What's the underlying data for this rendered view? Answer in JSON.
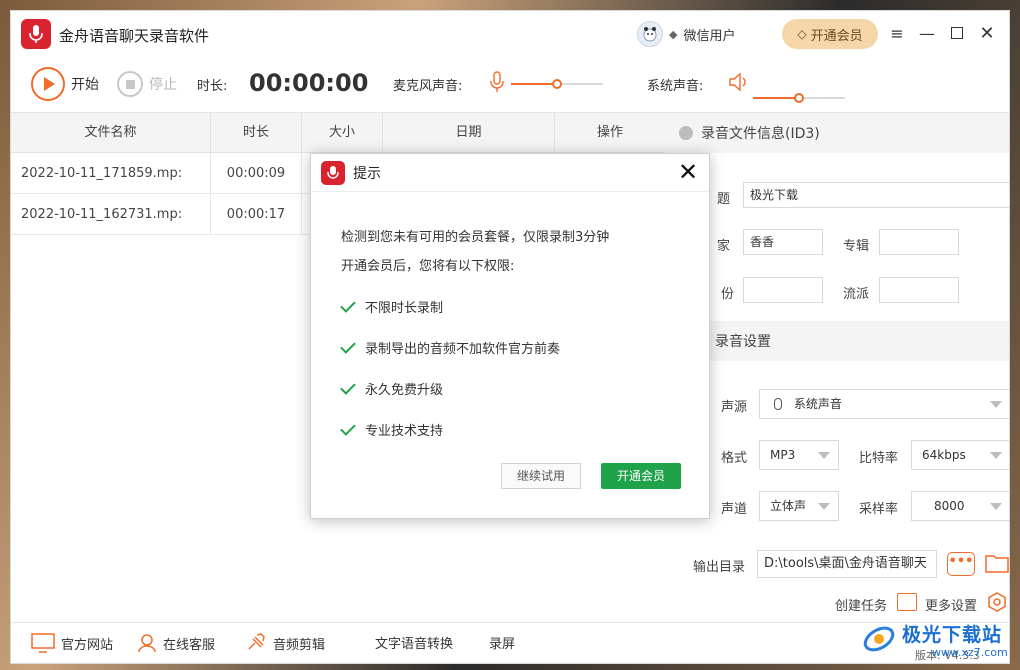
{
  "app": {
    "title": "金舟语音聊天录音软件"
  },
  "header": {
    "user_name": "微信用户",
    "vip_label": "开通会员"
  },
  "toolbar": {
    "start_label": "开始",
    "stop_label": "停止",
    "duration_label": "时长:",
    "timer": "00:00:00",
    "mic_label": "麦克风声音:",
    "mic_volume": 0.5,
    "system_label": "系统声音:",
    "system_volume": 0.5
  },
  "table": {
    "columns": [
      "文件名称",
      "时长",
      "大小",
      "日期",
      "操作"
    ],
    "rows": [
      {
        "name": "2022-10-11_171859.mp:",
        "duration": "00:00:09"
      },
      {
        "name": "2022-10-11_162731.mp:",
        "duration": "00:00:17"
      }
    ]
  },
  "right_panel": {
    "info_title": "录音文件信息(ID3)",
    "title_label": "题",
    "title_value": "极光下载",
    "artist_label": "家",
    "artist_value": "香香",
    "album_label": "专辑",
    "album_value": "",
    "year_label": "份",
    "year_value": "",
    "genre_label": "流派",
    "genre_value": "",
    "settings_title": "录音设置",
    "source_label": "声源",
    "source_value": "系统声音",
    "format_label": "格式",
    "format_value": "MP3",
    "bitrate_label": "比特率",
    "bitrate_value": "64kbps",
    "channel_label": "声道",
    "channel_value": "立体声",
    "samplerate_label": "采样率",
    "samplerate_value": "8000",
    "output_label": "输出目录",
    "output_value": "D:\\tools\\桌面\\金舟语音聊天",
    "create_task_label": "创建任务",
    "more_settings_label": "更多设置"
  },
  "bottom": {
    "website": "官方网站",
    "support": "在线客服",
    "audio_edit": "音频剪辑",
    "tts": "文字语音转换",
    "screen_rec": "录屏",
    "version": "版本: V4.3.3"
  },
  "dialog": {
    "title": "提示",
    "line1": "检测到您未有可用的会员套餐，仅限录制3分钟",
    "line2": "开通会员后，您将有以下权限:",
    "perks": [
      "不限时长录制",
      "录制导出的音频不加软件官方前奏",
      "永久免费升级",
      "专业技术支持"
    ],
    "trial_label": "继续试用",
    "vip_label": "开通会员"
  },
  "watermark": {
    "brand": "极光下载站",
    "url": "www.xz7.com"
  },
  "colors": {
    "accent": "#f06c2a",
    "brand_red": "#d9232e",
    "vip_gold": "#f5d6a8",
    "confirm_green": "#1fa24a"
  }
}
